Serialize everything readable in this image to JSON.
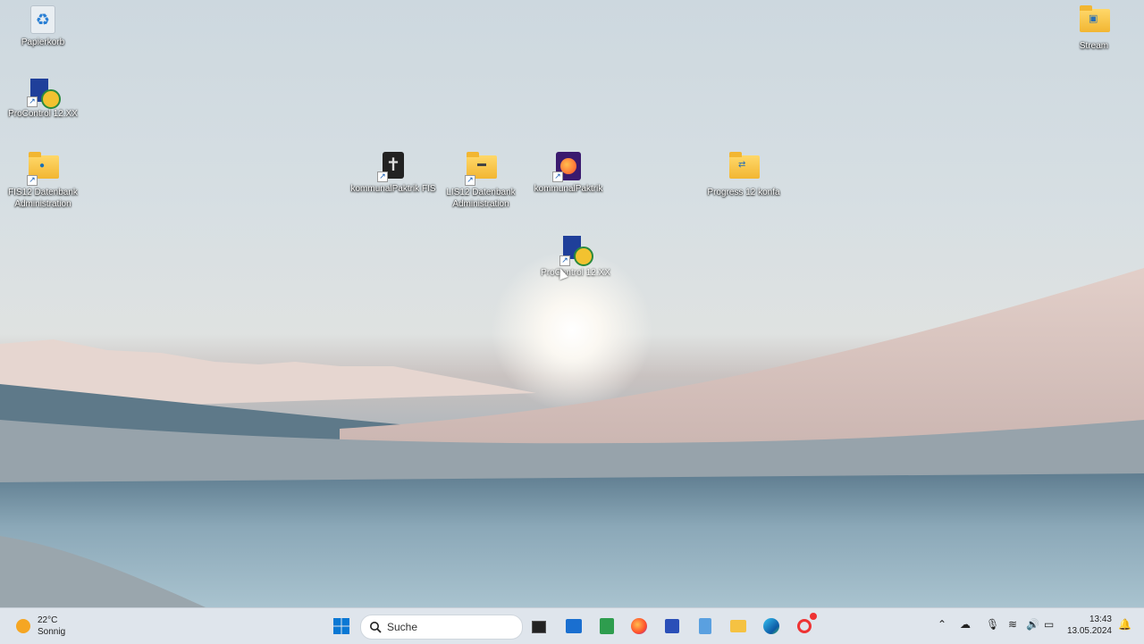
{
  "desktop": {
    "icons": [
      {
        "label": "Papierkorb",
        "icon": "recycle-bin-icon"
      },
      {
        "label": "ProControl 12.XX",
        "icon": "procontrol-icon"
      },
      {
        "label": "FIS12 Datenbank Administration",
        "icon": "folder-db-icon"
      },
      {
        "label": "kommunalPaktrik FIS",
        "icon": "cross-app-icon"
      },
      {
        "label": "LIS12 Datenbank Administration",
        "icon": "folder-db-icon"
      },
      {
        "label": "kommunalPaktrik",
        "icon": "firefox-icon"
      },
      {
        "label": "ProControl 12.XX",
        "icon": "procontrol-icon"
      },
      {
        "label": "Progress 12 konfa",
        "icon": "folder-icon"
      },
      {
        "label": "Stream",
        "icon": "folder-icon"
      }
    ]
  },
  "taskbar": {
    "weather": {
      "temp": "22°C",
      "condition": "Sonnig"
    },
    "search": {
      "placeholder": "Suche"
    },
    "clock": {
      "time": "13:43",
      "date": "13.05.2024"
    }
  }
}
